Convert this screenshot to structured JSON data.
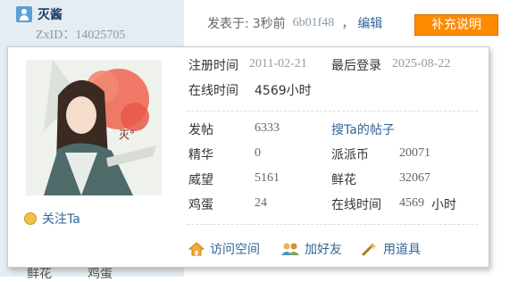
{
  "header": {
    "username": "灭酱",
    "zxid": "ZxID：14025705",
    "posted_label": "发表于:",
    "posted_time": "3秒前",
    "post_hash": "6b01f48",
    "comma": "，",
    "edit_label": "编辑",
    "supplement_label": "补充说明"
  },
  "card": {
    "follow_label": "关注Ta",
    "reg_time_label": "注册时间",
    "reg_time": "2011-02-21",
    "last_login_label": "最后登录",
    "last_login": "2025-08-22",
    "online_label": "在线时间",
    "online_value": "4569小时",
    "stats": {
      "posts_label": "发帖",
      "posts": "6333",
      "search_label": "搜Ta的帖子",
      "digest_label": "精华",
      "digest": "0",
      "coins_label": "派派币",
      "coins": "20071",
      "prestige_label": "威望",
      "prestige": "5161",
      "flowers_label": "鲜花",
      "flowers": "32067",
      "eggs_label": "鸡蛋",
      "eggs": "24",
      "online2_label": "在线时间",
      "online2_value": "4569",
      "online2_unit": "小时"
    },
    "actions": {
      "visit_label": "访问空间",
      "add_friend_label": "加好友",
      "use_item_label": "用道具"
    },
    "avatar_text": "灭°"
  },
  "bottom": {
    "flower_label": "鲜花",
    "egg_label": "鸡蛋"
  }
}
